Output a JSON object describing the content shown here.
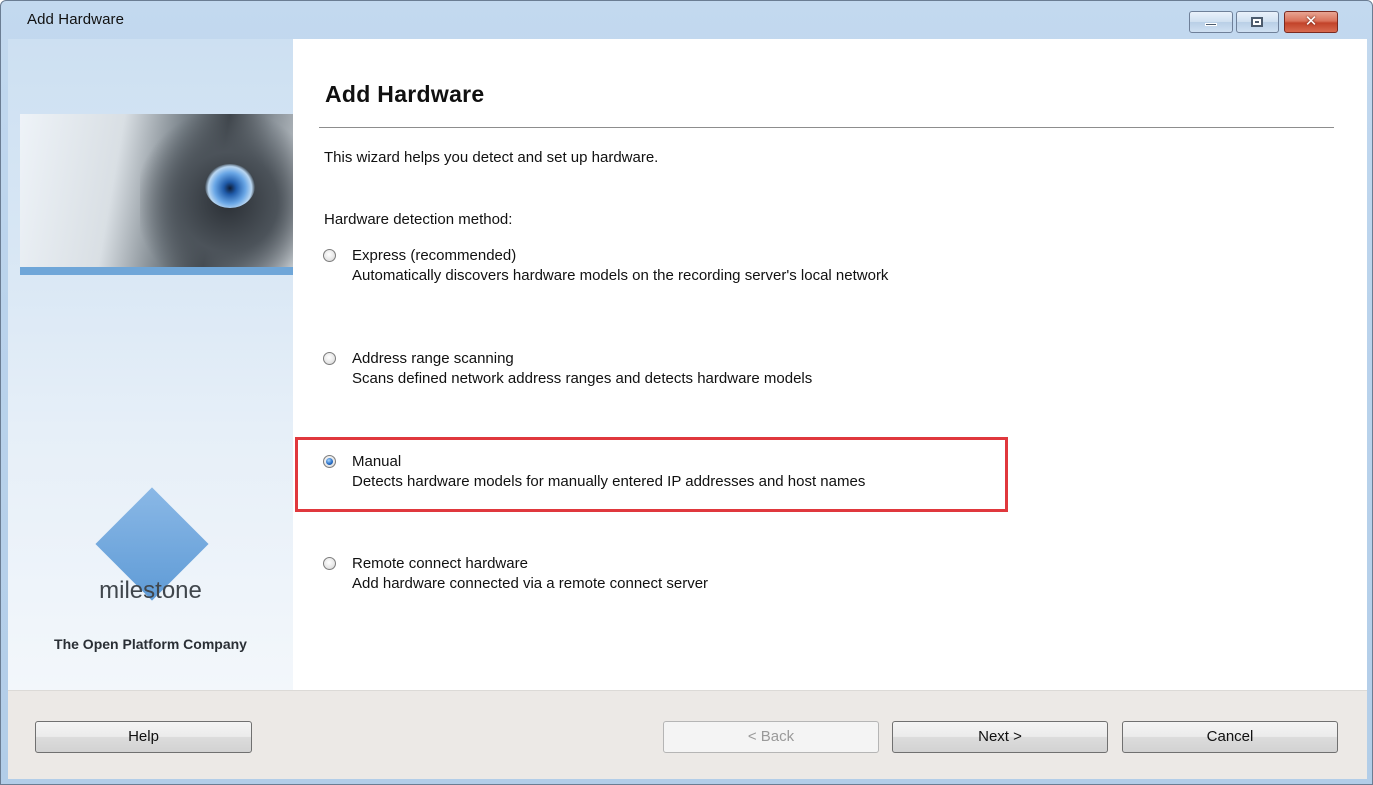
{
  "window": {
    "title": "Add Hardware",
    "controls": {
      "minimize_icon": "minimize-icon",
      "maximize_icon": "maximize-icon",
      "close_glyph": "✕"
    }
  },
  "sidebar": {
    "logo_text": "milestone",
    "tagline": "The Open Platform Company"
  },
  "main": {
    "title": "Add Hardware",
    "intro": "This wizard helps you detect and set up hardware.",
    "method_label": "Hardware detection method:",
    "options": [
      {
        "title": "Express (recommended)",
        "description": "Automatically discovers hardware models on the recording server's local network",
        "checked": false
      },
      {
        "title": "Address range scanning",
        "description": "Scans defined network address ranges and detects hardware models",
        "checked": false
      },
      {
        "title": "Manual",
        "description": "Detects hardware models for manually entered IP addresses and host names",
        "checked": true
      },
      {
        "title": "Remote connect hardware",
        "description": "Add hardware connected via a remote connect server",
        "checked": false
      }
    ],
    "highlight_color": "#e0383d"
  },
  "buttons": {
    "help": "Help",
    "back": "< Back",
    "next": "Next >",
    "cancel": "Cancel"
  }
}
